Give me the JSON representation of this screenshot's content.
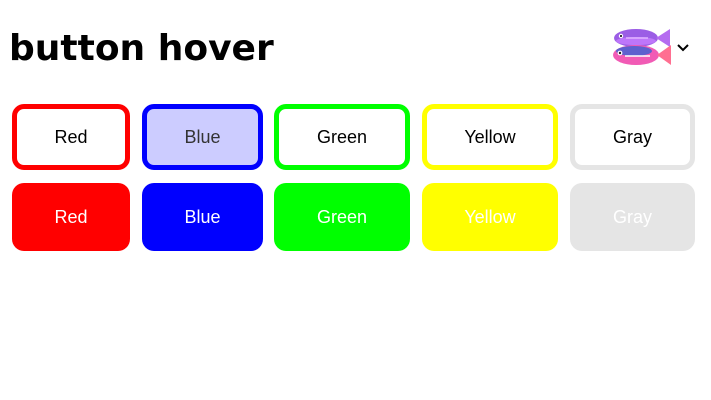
{
  "header": {
    "title": "button hover",
    "logo_icon": "fish-logo-icon",
    "menu_icon": "chevron-down-icon"
  },
  "outline_buttons": [
    {
      "label": "Red",
      "border": "#ff0000",
      "fill": "#ffffff",
      "text": "#000000"
    },
    {
      "label": "Blue",
      "border": "#0000ff",
      "fill": "#ccccff",
      "text": "#333333"
    },
    {
      "label": "Green",
      "border": "#00ff00",
      "fill": "#ffffff",
      "text": "#000000"
    },
    {
      "label": "Yellow",
      "border": "#ffff00",
      "fill": "#ffffff",
      "text": "#000000"
    },
    {
      "label": "Gray",
      "border": "#e5e5e5",
      "fill": "#ffffff",
      "text": "#000000"
    }
  ],
  "solid_buttons": [
    {
      "label": "Red",
      "fill": "#ff0000"
    },
    {
      "label": "Blue",
      "fill": "#0000ff"
    },
    {
      "label": "Green",
      "fill": "#00ff00"
    },
    {
      "label": "Yellow",
      "fill": "#ffff00"
    },
    {
      "label": "Gray",
      "fill": "#e5e5e5"
    }
  ]
}
